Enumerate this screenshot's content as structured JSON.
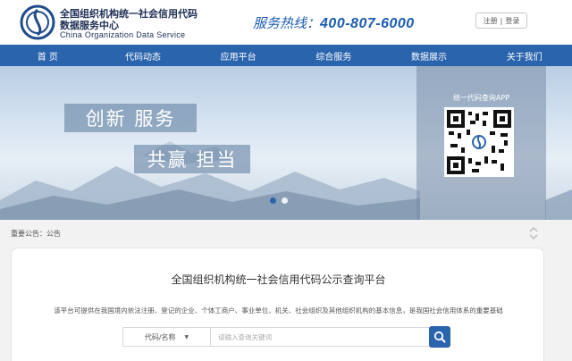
{
  "header": {
    "org_name_line1": "全国组织机构统一社会信用代码",
    "org_name_line2": "数据服务中心",
    "org_name_en": "China Organization Data Service",
    "hotline_label": "服务热线：",
    "hotline_number": "400-807-6000",
    "login_label": "注册",
    "separator": "|",
    "register_label": "登录"
  },
  "nav": {
    "items": [
      "首 页",
      "代码动态",
      "应用平台",
      "综合服务",
      "数据展示",
      "关于我们"
    ]
  },
  "banner": {
    "slogan_line1": "创新  服务",
    "slogan_line2": "共赢  担当",
    "qr_label": "统一代码查询APP",
    "slides": 2,
    "active_slide": 1
  },
  "notice": {
    "text": "重要公告：公告"
  },
  "search_card": {
    "title": "全国组织机构统一社会信用代码公示查询平台",
    "description": "该平台可提供在我国境内依法注册、登记的企业、个体工商户、事业单位、机关、社会组织及其他组织机构的基本信息，是我国社会信用体系的重要基础",
    "select_value": "代码/名称",
    "input_placeholder": "请输入查询关键词"
  },
  "colors": {
    "nav_blue": "#2a64ad",
    "brand_dark": "#1f2f55",
    "hotline_blue": "#1b5cb3"
  },
  "icons": {
    "logo": "organization-logo-icon",
    "search": "search-icon",
    "dropdown": "caret-down-icon",
    "scroll": "up-down-chevron-icon"
  }
}
